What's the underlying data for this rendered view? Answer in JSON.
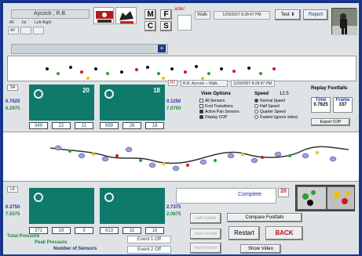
{
  "header": {
    "patient_name": "Aycock , R.B.",
    "button_m": "M",
    "button_f": "F",
    "button_c": "C",
    "button_s": "S",
    "mode_label": "ablel",
    "walk_label": "Walk",
    "walk_date": "1/29/2007 8:28:47 PM",
    "test_label": "Test",
    "report_label": "Report",
    "sub_tags": [
      "All",
      "Ist",
      "Left Right"
    ],
    "sub_value": "AF"
  },
  "left_panel": {
    "tag": "S4",
    "value_blue": "0.7625",
    "value_green": "0.2975",
    "cell_top": "20",
    "cell_right": "18",
    "stats": [
      "349",
      "22",
      "11",
      "699",
      "26",
      "18"
    ]
  },
  "right_values": {
    "blue": "0.1250",
    "green": "7.0750"
  },
  "info": {
    "tag": "R0",
    "session": "R.B. Aycock -- Walk",
    "date": "1/29/2007 8:28:47 PM"
  },
  "view_options": {
    "title": "View Options",
    "items": [
      "All Sensors",
      "Foot Transitions",
      "Active Pan Sensors",
      "Display COP"
    ],
    "checked": [
      false,
      false,
      true,
      true
    ]
  },
  "speed": {
    "title": "Speed",
    "value": "12.5",
    "items": [
      "Normal Speed",
      "Half Speed",
      "Quarter Speed",
      "Fastest (ignore video)"
    ],
    "selected": 0
  },
  "replay": {
    "title": "Replay Footfalls",
    "time_label": "Time",
    "time_value": "0.7625",
    "frame_label": "Frame",
    "frame_value": "337",
    "export_label": "Export COP"
  },
  "bottom_panel": {
    "tag": "L6",
    "value_blue": "0.3750",
    "value_green": "7.5575",
    "cell_top": "",
    "cell_right": "",
    "stats": [
      "372",
      "28",
      "9",
      "613",
      "32",
      "16"
    ],
    "right_blue": "2.7375",
    "right_green": "2.0875"
  },
  "complete": {
    "label": "Complete",
    "value": "20"
  },
  "pressure": {
    "total": "Total Pressure",
    "peak": "Peak Pressure",
    "sensors": "Number of Sensors"
  },
  "events": {
    "event1": "Event 1 Off",
    "event2": "Event 2 Off"
  },
  "side_buttons": [
    "Left Footfall",
    "Next Footfall",
    "Next Footfall"
  ],
  "actions": {
    "compare": "Compare Footfalls",
    "restart": "Restart",
    "back": "BACK",
    "video": "Show Video"
  },
  "colors": {
    "teal": "#0f7a6c",
    "blue": "#2134a0",
    "green": "#1b8a3a",
    "red": "#d01a1a"
  }
}
